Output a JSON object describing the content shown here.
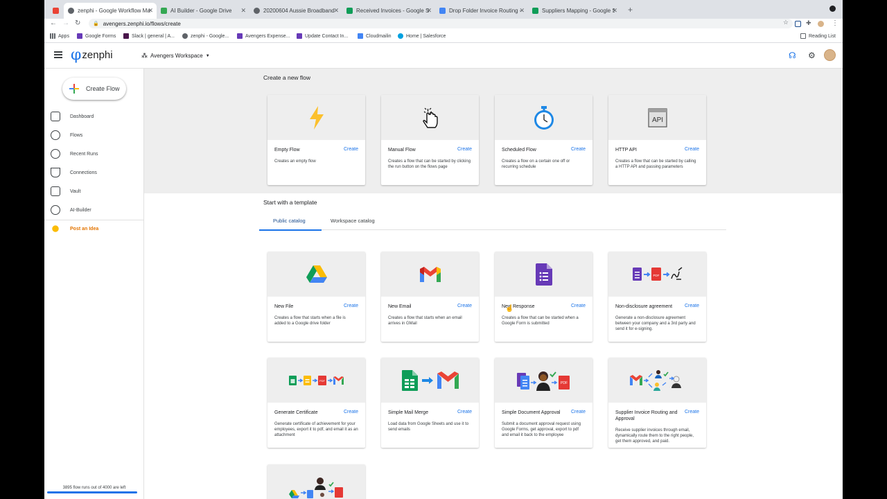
{
  "browser": {
    "tabs": [
      {
        "title": ""
      },
      {
        "title": "zenphi - Google Workflow Man"
      },
      {
        "title": "AI Builder - Google Drive"
      },
      {
        "title": "20200604 Aussie Broadband"
      },
      {
        "title": "Received Invoices - Google Sh"
      },
      {
        "title": "Drop Folder Invoice Routing -"
      },
      {
        "title": "Suppliers Mapping - Google Sh"
      }
    ],
    "url": "avengers.zenphi.io/flows/create",
    "bookmarks": [
      "Apps",
      "Google Forms",
      "Slack | general | A...",
      "zenphi - Google...",
      "Avengers Expense...",
      "Update Contact In...",
      "Cloudmailin",
      "Home | Salesforce"
    ],
    "reading_list": "Reading List"
  },
  "header": {
    "logo": "zenphi",
    "workspace": "Avengers Workspace"
  },
  "sidebar": {
    "create_flow": "Create Flow",
    "items": [
      {
        "label": "Dashboard",
        "icon": "dashboard-icon"
      },
      {
        "label": "Flows",
        "icon": "flows-icon"
      },
      {
        "label": "Recent Runs",
        "icon": "history-icon"
      },
      {
        "label": "Connections",
        "icon": "plug-icon"
      },
      {
        "label": "Vault",
        "icon": "vault-icon"
      },
      {
        "label": "AI-Builder",
        "icon": "brain-icon"
      }
    ],
    "post_idea": "Post an Idea",
    "quota_text": "3895 flow runs out of 4000 are left",
    "quota_fraction": 0.97
  },
  "create_section": {
    "title": "Create a new flow",
    "cards": [
      {
        "name": "Empty Flow",
        "action": "Create",
        "desc": "Creates an empty flow",
        "icon": "lightning-icon"
      },
      {
        "name": "Manual Flow",
        "action": "Create",
        "desc": "Creates a flow that can be started by clicking the run button on the flows page",
        "icon": "hand-pointer-icon"
      },
      {
        "name": "Scheduled Flow",
        "action": "Create",
        "desc": "Creates a flow on a certain one off or recurring schedule",
        "icon": "stopwatch-icon"
      },
      {
        "name": "HTTP API",
        "action": "Create",
        "desc": "Creates a flow that can be started by calling a HTTP API and passing parameters",
        "icon": "api-icon"
      }
    ]
  },
  "template_section": {
    "title": "Start with a template",
    "tabs": [
      "Public catalog",
      "Workspace catalog"
    ],
    "active_tab": "Public catalog",
    "api_label": "API",
    "cards": [
      {
        "name": "New File",
        "action": "Create",
        "desc": "Creates a flow that starts when a file is added to a Google drive folder",
        "icon": "google-drive-icon"
      },
      {
        "name": "New Email",
        "action": "Create",
        "desc": "Creates a flow that starts when an email arrives in GMail",
        "icon": "gmail-icon"
      },
      {
        "name": "New Response",
        "action": "Create",
        "desc": "Creates a flow that can be started when a Google Form is submitted",
        "icon": "google-forms-icon"
      },
      {
        "name": "Non-disclosure agreement",
        "action": "Create",
        "desc": "Generate a non-disclosure agreement between your company and a 3rd party and send it for e-signing.",
        "icon": "nda-flow-icon"
      },
      {
        "name": "Generate Certificate",
        "action": "Create",
        "desc": "Generate certificate of achievement for your employees, export it to pdf, and email it as an attachment",
        "icon": "certificate-flow-icon"
      },
      {
        "name": "Simple Mail Merge",
        "action": "Create",
        "desc": "Load data from Google Sheets and use it to send emails",
        "icon": "mail-merge-icon"
      },
      {
        "name": "Simple Document Approval",
        "action": "Create",
        "desc": "Submit a document approval request using Google Forms, get approval, export to pdf and email it back to the employee",
        "icon": "document-approval-icon"
      },
      {
        "name": "Supplier Invoice Routing and Approval",
        "action": "Create",
        "desc": "Receive supplier invoices through email, dynamically route them to the right people, get them approved, and paid.",
        "icon": "invoice-routing-icon"
      }
    ]
  },
  "colors": {
    "accent": "#1a73e8",
    "idea": "#e37400",
    "band": "#eeeeee"
  }
}
